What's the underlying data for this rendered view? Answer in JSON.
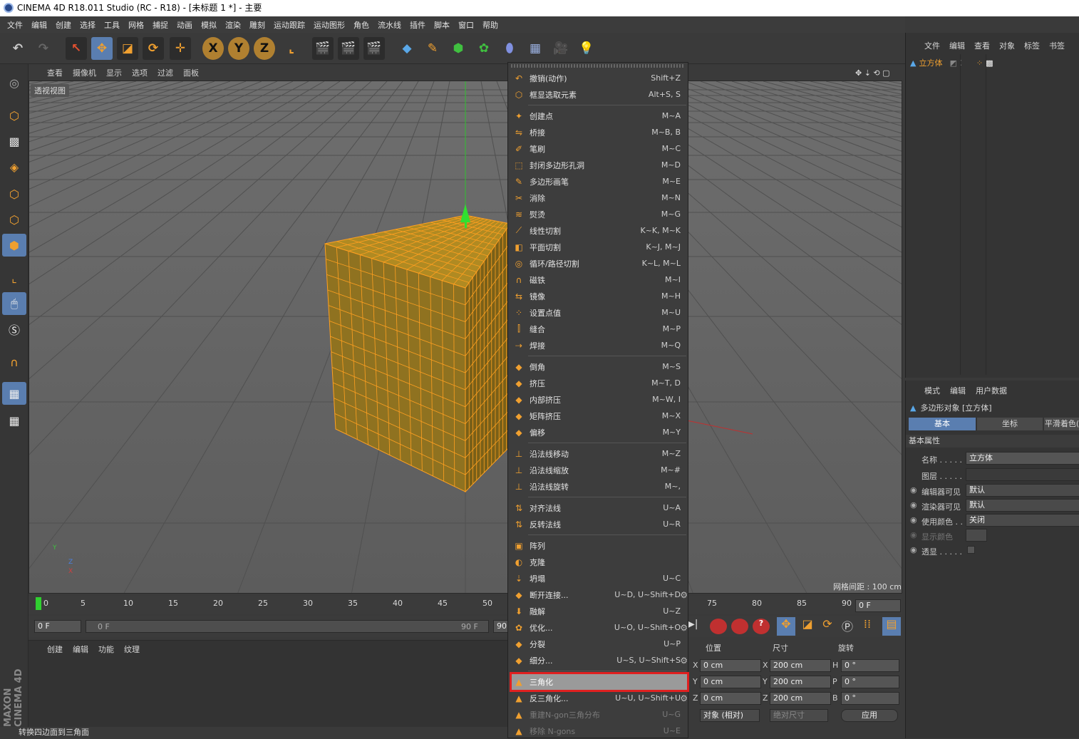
{
  "window": {
    "title": "CINEMA 4D R18.011 Studio (RC - R18) - [未标题 1 *] - 主要"
  },
  "menubar": [
    "文件",
    "编辑",
    "创建",
    "选择",
    "工具",
    "网格",
    "捕捉",
    "动画",
    "模拟",
    "渲染",
    "雕刻",
    "运动跟踪",
    "运动图形",
    "角色",
    "流水线",
    "插件",
    "脚本",
    "窗口",
    "帮助"
  ],
  "toolbar": {
    "axis_x": "X",
    "axis_y": "Y",
    "axis_z": "Z"
  },
  "viewport": {
    "menu": [
      "查看",
      "摄像机",
      "显示",
      "选项",
      "过滤",
      "面板"
    ],
    "label": "透视视图",
    "grid_spacing": "网格间距 : 100 cm",
    "axis_labels": {
      "y": "Y",
      "z": "Z",
      "x": "X"
    }
  },
  "timeline": {
    "ticks": [
      "0",
      "5",
      "10",
      "15",
      "20",
      "25",
      "30",
      "35",
      "40",
      "45",
      "50",
      "75",
      "80",
      "85",
      "90"
    ],
    "current_frame": "0 F"
  },
  "transport": {
    "start": "0 F",
    "range_start": "0 F",
    "range_end": "90 F",
    "end": "90"
  },
  "material_manager": {
    "menu": [
      "创建",
      "编辑",
      "功能",
      "纹理"
    ]
  },
  "status_bar": "转换四边面到三角面",
  "object_manager": {
    "menu": [
      "文件",
      "编辑",
      "查看",
      "对象",
      "标签",
      "书签"
    ],
    "object_name": "立方体"
  },
  "attribute_manager": {
    "menu": [
      "模式",
      "编辑",
      "用户数据"
    ],
    "object_title": "多边形对象 [立方体]",
    "tabs": [
      "基本",
      "坐标",
      "平滑着色("
    ],
    "section": "基本属性",
    "rows": [
      {
        "label": "名称 . . . . .",
        "value": "立方体"
      },
      {
        "label": "图层 . . . . .",
        "value": ""
      },
      {
        "label": "编辑器可见",
        "value": "默认"
      },
      {
        "label": "渲染器可见",
        "value": "默认"
      },
      {
        "label": "使用颜色 . .",
        "value": "关闭"
      },
      {
        "label": "显示颜色",
        "value": ""
      },
      {
        "label": "透显 . . . . .",
        "value": ""
      }
    ]
  },
  "coordinates": {
    "headers": [
      "位置",
      "尺寸",
      "旋转"
    ],
    "rows": [
      {
        "pl": "X",
        "pv": "0 cm",
        "sl": "X",
        "sv": "200 cm",
        "rl": "H",
        "rv": "0 °"
      },
      {
        "pl": "Y",
        "pv": "0 cm",
        "sl": "Y",
        "sv": "200 cm",
        "rl": "P",
        "rv": "0 °"
      },
      {
        "pl": "Z",
        "pv": "0 cm",
        "sl": "Z",
        "sv": "200 cm",
        "rl": "B",
        "rv": "0 °"
      }
    ],
    "mode": "对象 (相对)",
    "size_mode": "绝对尺寸",
    "apply": "应用"
  },
  "context_menu": {
    "items": [
      {
        "label": "撤销(动作)",
        "shortcut": "Shift+Z"
      },
      {
        "label": "框显选取元素",
        "shortcut": "Alt+S, S"
      },
      {
        "label": "创建点",
        "shortcut": "M~A"
      },
      {
        "label": "桥接",
        "shortcut": "M~B, B"
      },
      {
        "label": "笔刷",
        "shortcut": "M~C"
      },
      {
        "label": "封闭多边形孔洞",
        "shortcut": "M~D"
      },
      {
        "label": "多边形画笔",
        "shortcut": "M~E"
      },
      {
        "label": "消除",
        "shortcut": "M~N"
      },
      {
        "label": "熨烫",
        "shortcut": "M~G"
      },
      {
        "label": "线性切割",
        "shortcut": "K~K, M~K"
      },
      {
        "label": "平面切割",
        "shortcut": "K~J, M~J"
      },
      {
        "label": "循环/路径切割",
        "shortcut": "K~L, M~L"
      },
      {
        "label": "磁铁",
        "shortcut": "M~I"
      },
      {
        "label": "镜像",
        "shortcut": "M~H"
      },
      {
        "label": "设置点值",
        "shortcut": "M~U"
      },
      {
        "label": "缝合",
        "shortcut": "M~P"
      },
      {
        "label": "焊接",
        "shortcut": "M~Q"
      },
      {
        "label": "倒角",
        "shortcut": "M~S"
      },
      {
        "label": "挤压",
        "shortcut": "M~T, D"
      },
      {
        "label": "内部挤压",
        "shortcut": "M~W, I"
      },
      {
        "label": "矩阵挤压",
        "shortcut": "M~X"
      },
      {
        "label": "偏移",
        "shortcut": "M~Y"
      },
      {
        "label": "沿法线移动",
        "shortcut": "M~Z"
      },
      {
        "label": "沿法线缩放",
        "shortcut": "M~#"
      },
      {
        "label": "沿法线旋转",
        "shortcut": "M~,"
      },
      {
        "label": "对齐法线",
        "shortcut": "U~A"
      },
      {
        "label": "反转法线",
        "shortcut": "U~R"
      },
      {
        "label": "阵列",
        "shortcut": ""
      },
      {
        "label": "克隆",
        "shortcut": ""
      },
      {
        "label": "坍塌",
        "shortcut": "U~C"
      },
      {
        "label": "断开连接...",
        "shortcut": "U~D, U~Shift+D"
      },
      {
        "label": "融解",
        "shortcut": "U~Z"
      },
      {
        "label": "优化...",
        "shortcut": "U~O, U~Shift+O"
      },
      {
        "label": "分裂",
        "shortcut": "U~P"
      },
      {
        "label": "细分...",
        "shortcut": "U~S, U~Shift+S"
      },
      {
        "label": "三角化",
        "shortcut": ""
      },
      {
        "label": "反三角化...",
        "shortcut": "U~U, U~Shift+U"
      },
      {
        "label": "重建N-gon三角分布",
        "shortcut": "U~G"
      },
      {
        "label": "移除 N-gons",
        "shortcut": "U~E"
      }
    ]
  },
  "brand": {
    "text": "MAXON CINEMA 4D",
    "accent": "#f0a030",
    "selected": "#5a7eb0",
    "highlight": "#e02020"
  }
}
